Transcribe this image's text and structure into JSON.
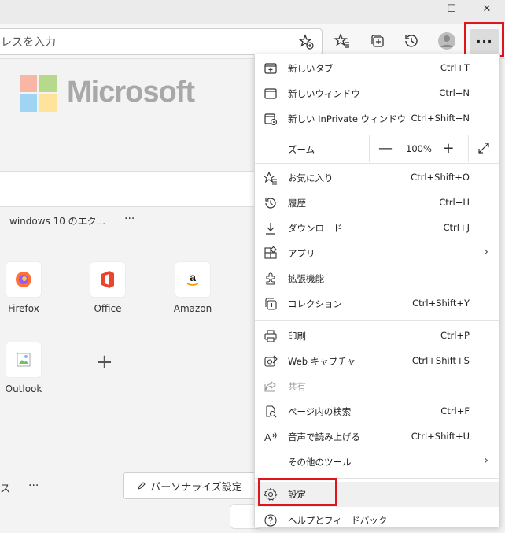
{
  "window": {
    "minimize": "—",
    "maximize": "☐",
    "close": "✕"
  },
  "address": {
    "partial_text": "レスを入力"
  },
  "newtab": {
    "brand": "Microsoft",
    "news_label": "windows 10 のエク...",
    "news_more": "···",
    "tiles": [
      {
        "label": "Firefox"
      },
      {
        "label": "Office"
      },
      {
        "label": "Amazon"
      },
      {
        "label": "Outlook"
      }
    ],
    "add_tile": "+",
    "bottom_label": "ス",
    "bottom_more": "···",
    "personalize_label": "パーソナライズ設定"
  },
  "menu": {
    "more_label": "···",
    "items": [
      {
        "label": "新しいタブ",
        "shortcut": "Ctrl+T"
      },
      {
        "label": "新しいウィンドウ",
        "shortcut": "Ctrl+N"
      },
      {
        "label": "新しい InPrivate ウィンドウ",
        "shortcut": "Ctrl+Shift+N"
      },
      {
        "label": "お気に入り",
        "shortcut": "Ctrl+Shift+O"
      },
      {
        "label": "履歴",
        "shortcut": "Ctrl+H"
      },
      {
        "label": "ダウンロード",
        "shortcut": "Ctrl+J"
      },
      {
        "label": "アプリ",
        "shortcut": ""
      },
      {
        "label": "拡張機能",
        "shortcut": ""
      },
      {
        "label": "コレクション",
        "shortcut": "Ctrl+Shift+Y"
      },
      {
        "label": "印刷",
        "shortcut": "Ctrl+P"
      },
      {
        "label": "Web キャプチャ",
        "shortcut": "Ctrl+Shift+S"
      },
      {
        "label": "共有",
        "shortcut": ""
      },
      {
        "label": "ページ内の検索",
        "shortcut": "Ctrl+F"
      },
      {
        "label": "音声で読み上げる",
        "shortcut": "Ctrl+Shift+U"
      },
      {
        "label": "その他のツール",
        "shortcut": ""
      },
      {
        "label": "設定",
        "shortcut": ""
      },
      {
        "label": "ヘルプとフィードバック",
        "shortcut": ""
      }
    ],
    "zoom": {
      "label": "ズーム",
      "value": "100%",
      "minus": "—",
      "plus": "+"
    }
  },
  "colors": {
    "highlight": "#e0141c"
  }
}
